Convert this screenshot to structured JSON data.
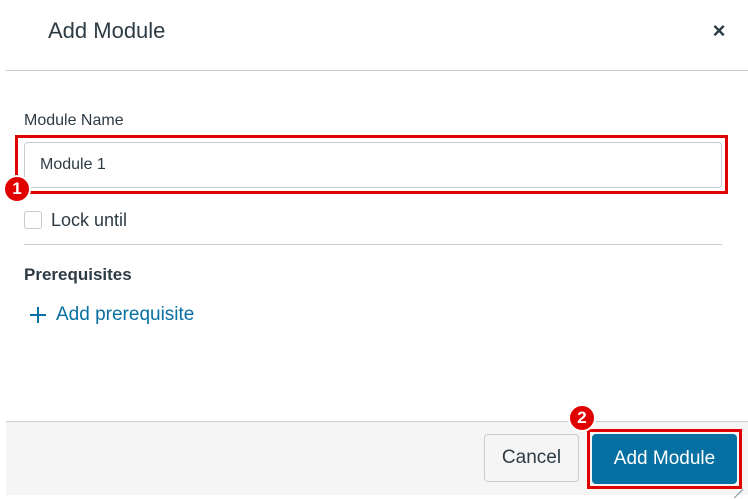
{
  "dialog": {
    "title": "Add Module",
    "close_label": "×"
  },
  "form": {
    "name_label": "Module Name",
    "name_value": "Module 1",
    "lock_label": "Lock until",
    "lock_checked": false,
    "prereq_heading": "Prerequisites",
    "add_prereq_label": "Add prerequisite"
  },
  "footer": {
    "cancel_label": "Cancel",
    "submit_label": "Add Module"
  },
  "callouts": [
    {
      "number": "1"
    },
    {
      "number": "2"
    }
  ],
  "colors": {
    "accent": "#0770a3",
    "callout": "#e10000",
    "text": "#2d3b45",
    "border": "#c7cdd1"
  },
  "icons": {
    "close": "close-icon",
    "add": "plus-icon",
    "resize": "resize-grip-icon"
  }
}
